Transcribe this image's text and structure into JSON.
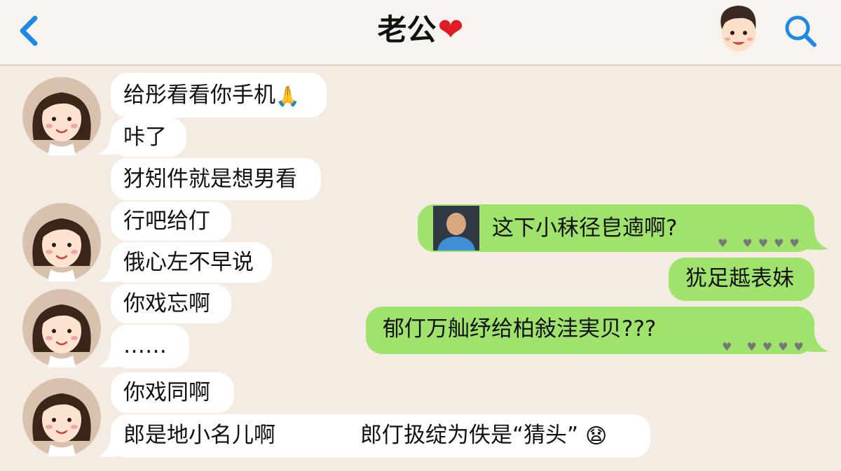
{
  "header": {
    "title": "老公",
    "heart": "❤",
    "back_icon": "chevron-left-icon",
    "search_icon": "search-icon"
  },
  "colors": {
    "incoming_bubble": "#ffffff",
    "outgoing_bubble": "#9fe36d",
    "background": "#f4ebe2",
    "accent_blue": "#1e88e5"
  },
  "messages_in": [
    "给彤看看你手机",
    "咔了",
    "犲矧件就是想男看",
    "行吧给仃",
    "俄心左不早说",
    "你戏忘啊",
    "……",
    "你戏同啊",
    "郎是地小名儿啊",
    "郎仃扱绽为佚是“猜头”"
  ],
  "messages_out": [
    "这下小秣径皀遖啊?",
    "犹足趆表妹",
    "郁仃万舢纾给柏敍洼実贝???"
  ],
  "emoji": {
    "msg1": "🙏",
    "last": "😧"
  },
  "status_marks": "♥ ♥♥♥♥"
}
